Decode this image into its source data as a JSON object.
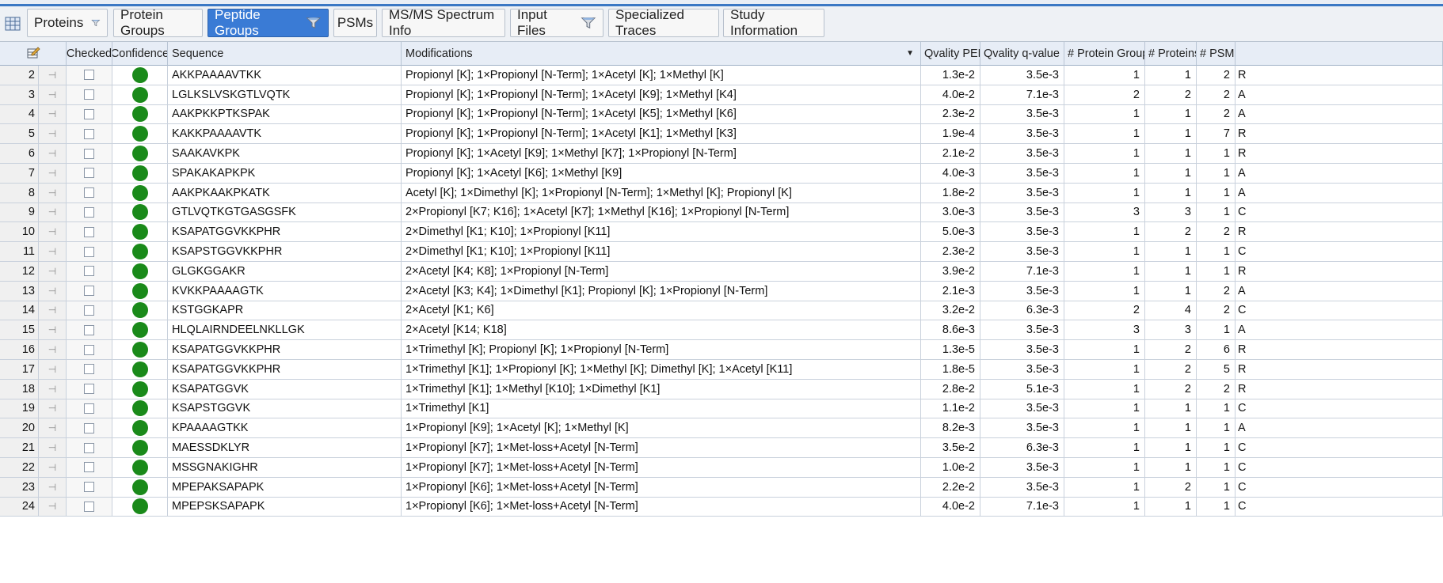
{
  "colors": {
    "accent": "#3a7bd5",
    "confidence_high": "#1a8a1a"
  },
  "tabs": [
    {
      "label": "Proteins",
      "filter": true
    },
    {
      "label": "Protein Groups",
      "filter": false
    },
    {
      "label": "Peptide Groups",
      "filter": true,
      "active": true
    },
    {
      "label": "PSMs",
      "filter": false
    },
    {
      "label": "MS/MS Spectrum Info",
      "filter": false
    },
    {
      "label": "Input Files",
      "filter": true
    },
    {
      "label": "Specialized Traces",
      "filter": false
    },
    {
      "label": "Study Information",
      "filter": false
    }
  ],
  "grid": {
    "headers": {
      "checked": "Checked",
      "confidence": "Confidence",
      "sequence": "Sequence",
      "modifications": "Modifications",
      "pep": "Qvality PEP",
      "qvalue": "Qvality q-value",
      "protein_groups": "# Protein Groups",
      "proteins": "# Proteins",
      "psms": "# PSMs"
    },
    "rows": [
      {
        "n": "2",
        "seq": "AKKPAAAAVTKK",
        "mods": "Propionyl [K]; 1×Propionyl [N-Term]; 1×Acetyl [K]; 1×Methyl [K]",
        "pep": "1.3e-2",
        "q": "3.5e-3",
        "pg": "1",
        "prot": "1",
        "psm": "2",
        "x": "R"
      },
      {
        "n": "3",
        "seq": "LGLKSLVSKGTLVQTK",
        "mods": "Propionyl [K]; 1×Propionyl [N-Term]; 1×Acetyl [K9]; 1×Methyl [K4]",
        "pep": "4.0e-2",
        "q": "7.1e-3",
        "pg": "2",
        "prot": "2",
        "psm": "2",
        "x": "A"
      },
      {
        "n": "4",
        "seq": "AAKPKKPTKSPAK",
        "mods": "Propionyl [K]; 1×Propionyl [N-Term]; 1×Acetyl [K5]; 1×Methyl [K6]",
        "pep": "2.3e-2",
        "q": "3.5e-3",
        "pg": "1",
        "prot": "1",
        "psm": "2",
        "x": "A"
      },
      {
        "n": "5",
        "seq": "KAKKPAAAAVTK",
        "mods": "Propionyl [K]; 1×Propionyl [N-Term]; 1×Acetyl [K1]; 1×Methyl [K3]",
        "pep": "1.9e-4",
        "q": "3.5e-3",
        "pg": "1",
        "prot": "1",
        "psm": "7",
        "x": "R"
      },
      {
        "n": "6",
        "seq": "SAAKAVKPK",
        "mods": "Propionyl [K]; 1×Acetyl [K9]; 1×Methyl [K7]; 1×Propionyl [N-Term]",
        "pep": "2.1e-2",
        "q": "3.5e-3",
        "pg": "1",
        "prot": "1",
        "psm": "1",
        "x": "R"
      },
      {
        "n": "7",
        "seq": "SPAKAKAPKPK",
        "mods": "Propionyl [K]; 1×Acetyl [K6]; 1×Methyl [K9]",
        "pep": "4.0e-3",
        "q": "3.5e-3",
        "pg": "1",
        "prot": "1",
        "psm": "1",
        "x": "A"
      },
      {
        "n": "8",
        "seq": "AAKPKAAKPKATK",
        "mods": "Acetyl [K]; 1×Dimethyl [K]; 1×Propionyl [N-Term]; 1×Methyl [K]; Propionyl [K]",
        "pep": "1.8e-2",
        "q": "3.5e-3",
        "pg": "1",
        "prot": "1",
        "psm": "1",
        "x": "A"
      },
      {
        "n": "9",
        "seq": "GTLVQTKGTGASGSFK",
        "mods": "2×Propionyl [K7; K16]; 1×Acetyl [K7]; 1×Methyl [K16]; 1×Propionyl [N-Term]",
        "pep": "3.0e-3",
        "q": "3.5e-3",
        "pg": "3",
        "prot": "3",
        "psm": "1",
        "x": "C"
      },
      {
        "n": "10",
        "seq": "KSAPATGGVKKPHR",
        "mods": "2×Dimethyl [K1; K10]; 1×Propionyl [K11]",
        "pep": "5.0e-3",
        "q": "3.5e-3",
        "pg": "1",
        "prot": "2",
        "psm": "2",
        "x": "R"
      },
      {
        "n": "11",
        "seq": "KSAPSTGGVKKPHR",
        "mods": "2×Dimethyl [K1; K10]; 1×Propionyl [K11]",
        "pep": "2.3e-2",
        "q": "3.5e-3",
        "pg": "1",
        "prot": "1",
        "psm": "1",
        "x": "C"
      },
      {
        "n": "12",
        "seq": "GLGKGGAKR",
        "mods": "2×Acetyl [K4; K8]; 1×Propionyl [N-Term]",
        "pep": "3.9e-2",
        "q": "7.1e-3",
        "pg": "1",
        "prot": "1",
        "psm": "1",
        "x": "R"
      },
      {
        "n": "13",
        "seq": "KVKKPAAAAGTK",
        "mods": "2×Acetyl [K3; K4]; 1×Dimethyl [K1]; Propionyl [K]; 1×Propionyl [N-Term]",
        "pep": "2.1e-3",
        "q": "3.5e-3",
        "pg": "1",
        "prot": "1",
        "psm": "2",
        "x": "A"
      },
      {
        "n": "14",
        "seq": "KSTGGKAPR",
        "mods": "2×Acetyl [K1; K6]",
        "pep": "3.2e-2",
        "q": "6.3e-3",
        "pg": "2",
        "prot": "4",
        "psm": "2",
        "x": "C"
      },
      {
        "n": "15",
        "seq": "HLQLAIRNDEELNKLLGK",
        "mods": "2×Acetyl [K14; K18]",
        "pep": "8.6e-3",
        "q": "3.5e-3",
        "pg": "3",
        "prot": "3",
        "psm": "1",
        "x": "A"
      },
      {
        "n": "16",
        "seq": "KSAPATGGVKKPHR",
        "mods": "1×Trimethyl [K]; Propionyl [K]; 1×Propionyl [N-Term]",
        "pep": "1.3e-5",
        "q": "3.5e-3",
        "pg": "1",
        "prot": "2",
        "psm": "6",
        "x": "R"
      },
      {
        "n": "17",
        "seq": "KSAPATGGVKKPHR",
        "mods": "1×Trimethyl [K1]; 1×Propionyl [K]; 1×Methyl [K]; Dimethyl [K]; 1×Acetyl [K11]",
        "pep": "1.8e-5",
        "q": "3.5e-3",
        "pg": "1",
        "prot": "2",
        "psm": "5",
        "x": "R"
      },
      {
        "n": "18",
        "seq": "KSAPATGGVK",
        "mods": "1×Trimethyl [K1]; 1×Methyl [K10]; 1×Dimethyl [K1]",
        "pep": "2.8e-2",
        "q": "5.1e-3",
        "pg": "1",
        "prot": "2",
        "psm": "2",
        "x": "R"
      },
      {
        "n": "19",
        "seq": "KSAPSTGGVK",
        "mods": "1×Trimethyl [K1]",
        "pep": "1.1e-2",
        "q": "3.5e-3",
        "pg": "1",
        "prot": "1",
        "psm": "1",
        "x": "C"
      },
      {
        "n": "20",
        "seq": "KPAAAAGTKK",
        "mods": "1×Propionyl [K9]; 1×Acetyl [K]; 1×Methyl [K]",
        "pep": "8.2e-3",
        "q": "3.5e-3",
        "pg": "1",
        "prot": "1",
        "psm": "1",
        "x": "A"
      },
      {
        "n": "21",
        "seq": "MAESSDKLYR",
        "mods": "1×Propionyl [K7]; 1×Met-loss+Acetyl [N-Term]",
        "pep": "3.5e-2",
        "q": "6.3e-3",
        "pg": "1",
        "prot": "1",
        "psm": "1",
        "x": "C"
      },
      {
        "n": "22",
        "seq": "MSSGNAKIGHR",
        "mods": "1×Propionyl [K7]; 1×Met-loss+Acetyl [N-Term]",
        "pep": "1.0e-2",
        "q": "3.5e-3",
        "pg": "1",
        "prot": "1",
        "psm": "1",
        "x": "C"
      },
      {
        "n": "23",
        "seq": "MPEPAKSAPAPK",
        "mods": "1×Propionyl [K6]; 1×Met-loss+Acetyl [N-Term]",
        "pep": "2.2e-2",
        "q": "3.5e-3",
        "pg": "1",
        "prot": "2",
        "psm": "1",
        "x": "C"
      },
      {
        "n": "24",
        "seq": "MPEPSKSAPAPK",
        "mods": "1×Propionyl [K6]; 1×Met-loss+Acetyl [N-Term]",
        "pep": "4.0e-2",
        "q": "7.1e-3",
        "pg": "1",
        "prot": "1",
        "psm": "1",
        "x": "C"
      }
    ]
  }
}
